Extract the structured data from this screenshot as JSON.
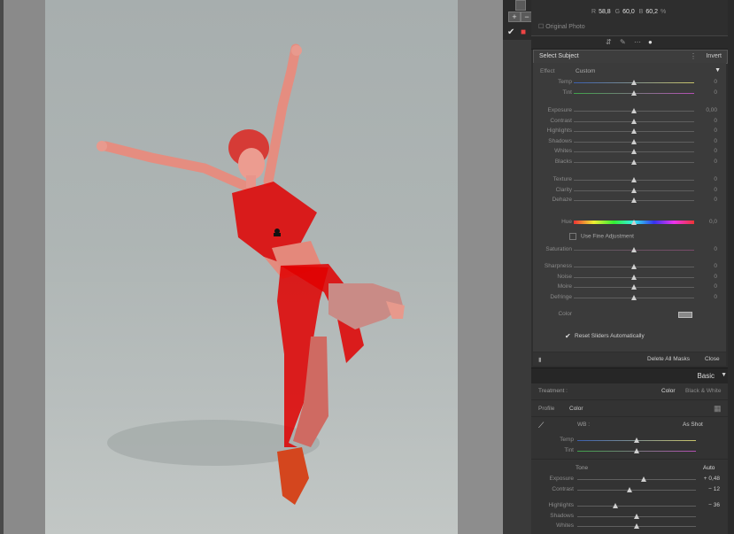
{
  "histogram_readout": {
    "r_label": "R",
    "r_value": "58,8",
    "g_label": "G",
    "g_value": "60,0",
    "b_label": "B",
    "b_value": "60,2",
    "unit": "%"
  },
  "original_photo_label": "Original Photo",
  "mask_name": "Select Subject",
  "invert_label": "Invert",
  "effect": {
    "label": "Effect",
    "preset": "Custom"
  },
  "mask_sliders_1": [
    {
      "label": "Temp",
      "value": "0",
      "pos": 0.5,
      "color": "temp"
    },
    {
      "label": "Tint",
      "value": "0",
      "pos": 0.5,
      "color": "tint"
    }
  ],
  "mask_sliders_2": [
    {
      "label": "Exposure",
      "value": "0,00",
      "pos": 0.5
    },
    {
      "label": "Contrast",
      "value": "0",
      "pos": 0.5
    },
    {
      "label": "Highlights",
      "value": "0",
      "pos": 0.5
    },
    {
      "label": "Shadows",
      "value": "0",
      "pos": 0.5
    },
    {
      "label": "Whites",
      "value": "0",
      "pos": 0.5
    },
    {
      "label": "Blacks",
      "value": "0",
      "pos": 0.5
    }
  ],
  "mask_sliders_3": [
    {
      "label": "Texture",
      "value": "0",
      "pos": 0.5
    },
    {
      "label": "Clarity",
      "value": "0",
      "pos": 0.5
    },
    {
      "label": "Dehaze",
      "value": "0",
      "pos": 0.5
    }
  ],
  "hue": {
    "label": "Hue",
    "value": "0,0",
    "pos": 0.5
  },
  "fine_adjust_label": "Use Fine Adjustment",
  "saturation": {
    "label": "Saturation",
    "value": "0",
    "pos": 0.5
  },
  "mask_sliders_4": [
    {
      "label": "Sharpness",
      "value": "0",
      "pos": 0.5
    },
    {
      "label": "Noise",
      "value": "0",
      "pos": 0.5
    },
    {
      "label": "Moire",
      "value": "0",
      "pos": 0.5
    },
    {
      "label": "Defringe",
      "value": "0",
      "pos": 0.5
    }
  ],
  "color_label": "Color",
  "reset_label": "Reset Sliders Automatically",
  "footer": {
    "delete_all": "Delete All Masks",
    "close": "Close"
  },
  "basic": {
    "title": "Basic",
    "treatment_label": "Treatment :",
    "color_option": "Color",
    "bw_option": "Black & White",
    "profile_label": "Profile",
    "profile_value": "Color",
    "wb_label": "WB :",
    "wb_value": "As Shot",
    "temp": {
      "label": "Temp",
      "value": "",
      "pos": 0.5
    },
    "tint": {
      "label": "Tint",
      "value": "",
      "pos": 0.5
    },
    "tone_label": "Tone",
    "auto_label": "Auto",
    "tone_sliders": [
      {
        "label": "Exposure",
        "value": "+ 0,48",
        "pos": 0.56
      },
      {
        "label": "Contrast",
        "value": "− 12",
        "pos": 0.44
      }
    ],
    "tone_sliders_2": [
      {
        "label": "Highlights",
        "value": "− 36",
        "pos": 0.32
      },
      {
        "label": "Shadows",
        "value": "",
        "pos": 0.5
      },
      {
        "label": "Whites",
        "value": "",
        "pos": 0.5
      }
    ]
  },
  "colors": {
    "mask_overlay": "#e00000",
    "panel_bg": "#3b3b3b",
    "accent": "#dddddd"
  }
}
